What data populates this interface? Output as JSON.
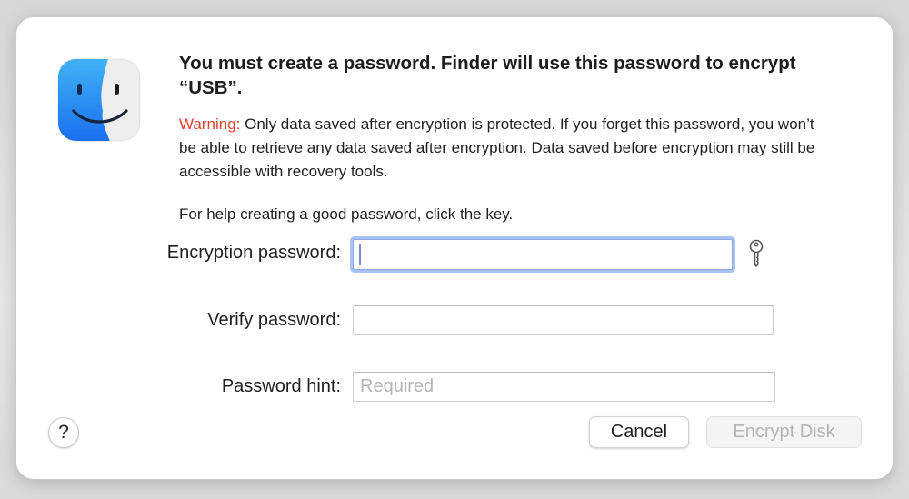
{
  "dialog": {
    "app_icon": "finder-icon",
    "title": "You must create a password. Finder will use this password to encrypt “USB”.",
    "warning_label": "Warning:",
    "warning_text": " Only data saved after encryption is protected. If you forget this password, you won’t be able to retrieve any data saved after encryption. Data saved before encryption may still be accessible with recovery tools.",
    "help_text": "For help creating a good password, click the key."
  },
  "form": {
    "encryption_password": {
      "label": "Encryption password:",
      "value": "",
      "key_icon": "key-icon"
    },
    "verify_password": {
      "label": "Verify password:",
      "value": ""
    },
    "password_hint": {
      "label": "Password hint:",
      "value": "",
      "placeholder": "Required"
    }
  },
  "buttons": {
    "help": "?",
    "cancel": "Cancel",
    "encrypt": "Encrypt Disk"
  },
  "colors": {
    "warning": "#e0432f",
    "focus_ring": "#a9c2f3",
    "disabled_text": "#b4b4b4"
  }
}
